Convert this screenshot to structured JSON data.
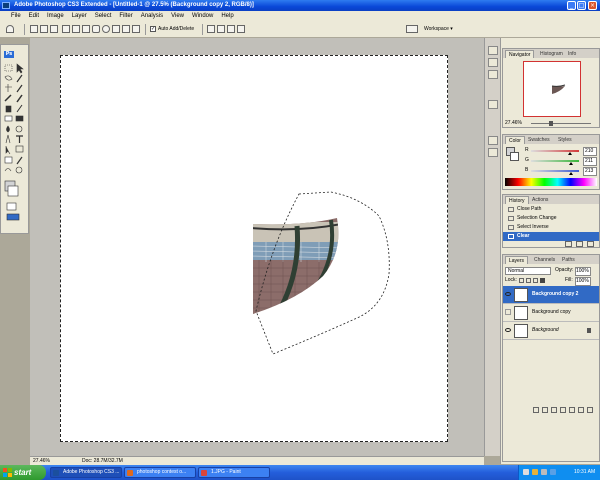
{
  "window": {
    "title": "Adobe Photoshop CS3 Extended - [Untitled-1 @ 27.5% (Background copy 2, RGB/8)]"
  },
  "menu": [
    "File",
    "Edit",
    "Image",
    "Layer",
    "Select",
    "Filter",
    "Analysis",
    "View",
    "Window",
    "Help"
  ],
  "options": {
    "auto_add_delete": "Auto Add/Delete",
    "workspace": "Workspace ▾"
  },
  "toolbox": {
    "logo": "Ps"
  },
  "status": {
    "zoom": "27.46%",
    "doc": "Doc: 28.7M/32.7M"
  },
  "navigator": {
    "tabs": [
      "Navigator",
      "Histogram",
      "Info"
    ],
    "zoom": "27.46%"
  },
  "color": {
    "tabs": [
      "Color",
      "Swatches",
      "Styles"
    ],
    "channels": [
      {
        "label": "R",
        "value": "210",
        "fraction": 0.82,
        "color": "#d23a3a"
      },
      {
        "label": "G",
        "value": "211",
        "fraction": 0.83,
        "color": "#3ab53a"
      },
      {
        "label": "B",
        "value": "213",
        "fraction": 0.84,
        "color": "#3a5ad2"
      }
    ]
  },
  "history": {
    "tabs": [
      "History",
      "Actions"
    ],
    "items": [
      "Close Path",
      "Selection Change",
      "Select Inverse",
      "Clear"
    ],
    "selected_index": 3
  },
  "layers": {
    "tabs": [
      "Layers",
      "Channels",
      "Paths"
    ],
    "blend_mode": "Normal",
    "opacity_label": "Opacity:",
    "opacity": "100%",
    "lock_label": "Lock:",
    "fill_label": "Fill:",
    "fill": "100%",
    "items": [
      {
        "name": "Background copy 2",
        "visible": true,
        "selected": true
      },
      {
        "name": "Background copy",
        "visible": false,
        "selected": false
      },
      {
        "name": "Background",
        "visible": true,
        "selected": false
      }
    ]
  },
  "taskbar": {
    "start": "start",
    "tasks": [
      {
        "label": "Adobe Photoshop CS3 ...",
        "active": true,
        "color": "#1b4f9e"
      },
      {
        "label": "photoshop contest o...",
        "active": false,
        "color": "#e06a1f"
      },
      {
        "label": "1.JPG - Paint",
        "active": false,
        "color": "#d9453a"
      }
    ],
    "clock": "10:31 AM"
  },
  "colors": {
    "accent": "#316ac5",
    "xp_blue": "#245edb",
    "start_green": "#3aa03a"
  }
}
